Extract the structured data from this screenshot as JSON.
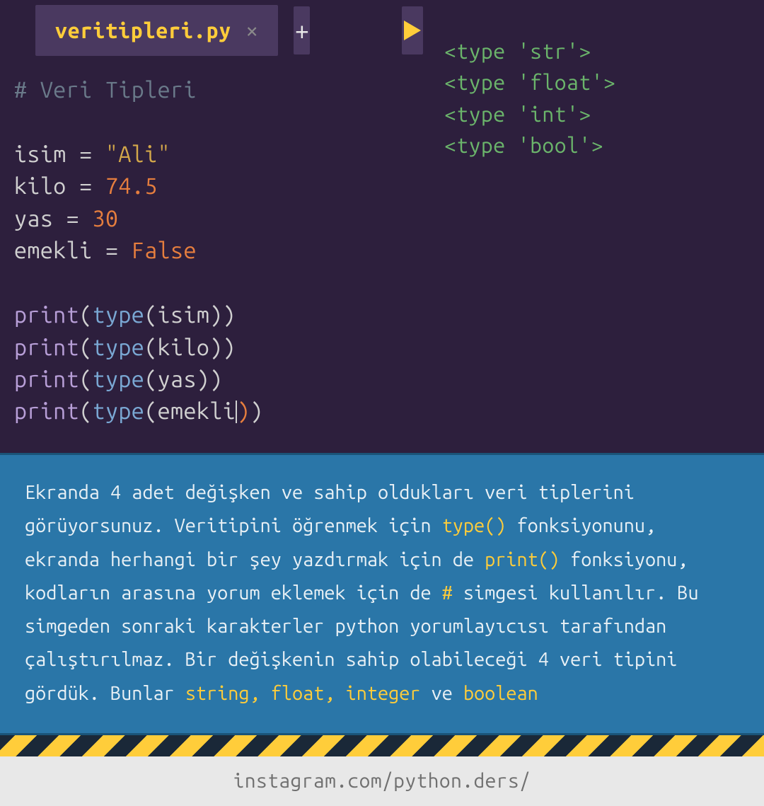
{
  "tab": {
    "filename": "veritipleri.py"
  },
  "code": {
    "comment": "# Veri Tipleri",
    "var1": "isim",
    "val1": "\"Ali\"",
    "var2": "kilo",
    "val2": "74.5",
    "var3": "yas",
    "val3": "30",
    "var4": "emekli",
    "val4": "False",
    "print": "print",
    "type": "type",
    "eq": " = "
  },
  "output": {
    "line1": "<type 'str'>",
    "line2": "<type 'float'>",
    "line3": "<type 'int'>",
    "line4": "<type 'bool'>"
  },
  "info": {
    "t1": "Ekranda 4 adet değişken ve sahip oldukları veri tiplerini görüyorsunuz. Veritipini öğrenmek için ",
    "h1": "type()",
    "t2": " fonksiyonunu, ekranda herhangi bir şey yazdırmak için de ",
    "h2": "print()",
    "t3": " fonksiyonu, kodların arasına yorum eklemek için de ",
    "h3": "#",
    "t4": " simgesi kullanılır. Bu simgeden sonraki karakterler python yorumlayıcısı tarafından çalıştırılmaz. Bir değişkenin sahip olabileceği 4 veri tipini gördük. Bunlar ",
    "h4": "string, float, integer",
    "t5": " ve ",
    "h5": "boolean"
  },
  "footer": {
    "text": "instagram.com/python.ders/"
  }
}
